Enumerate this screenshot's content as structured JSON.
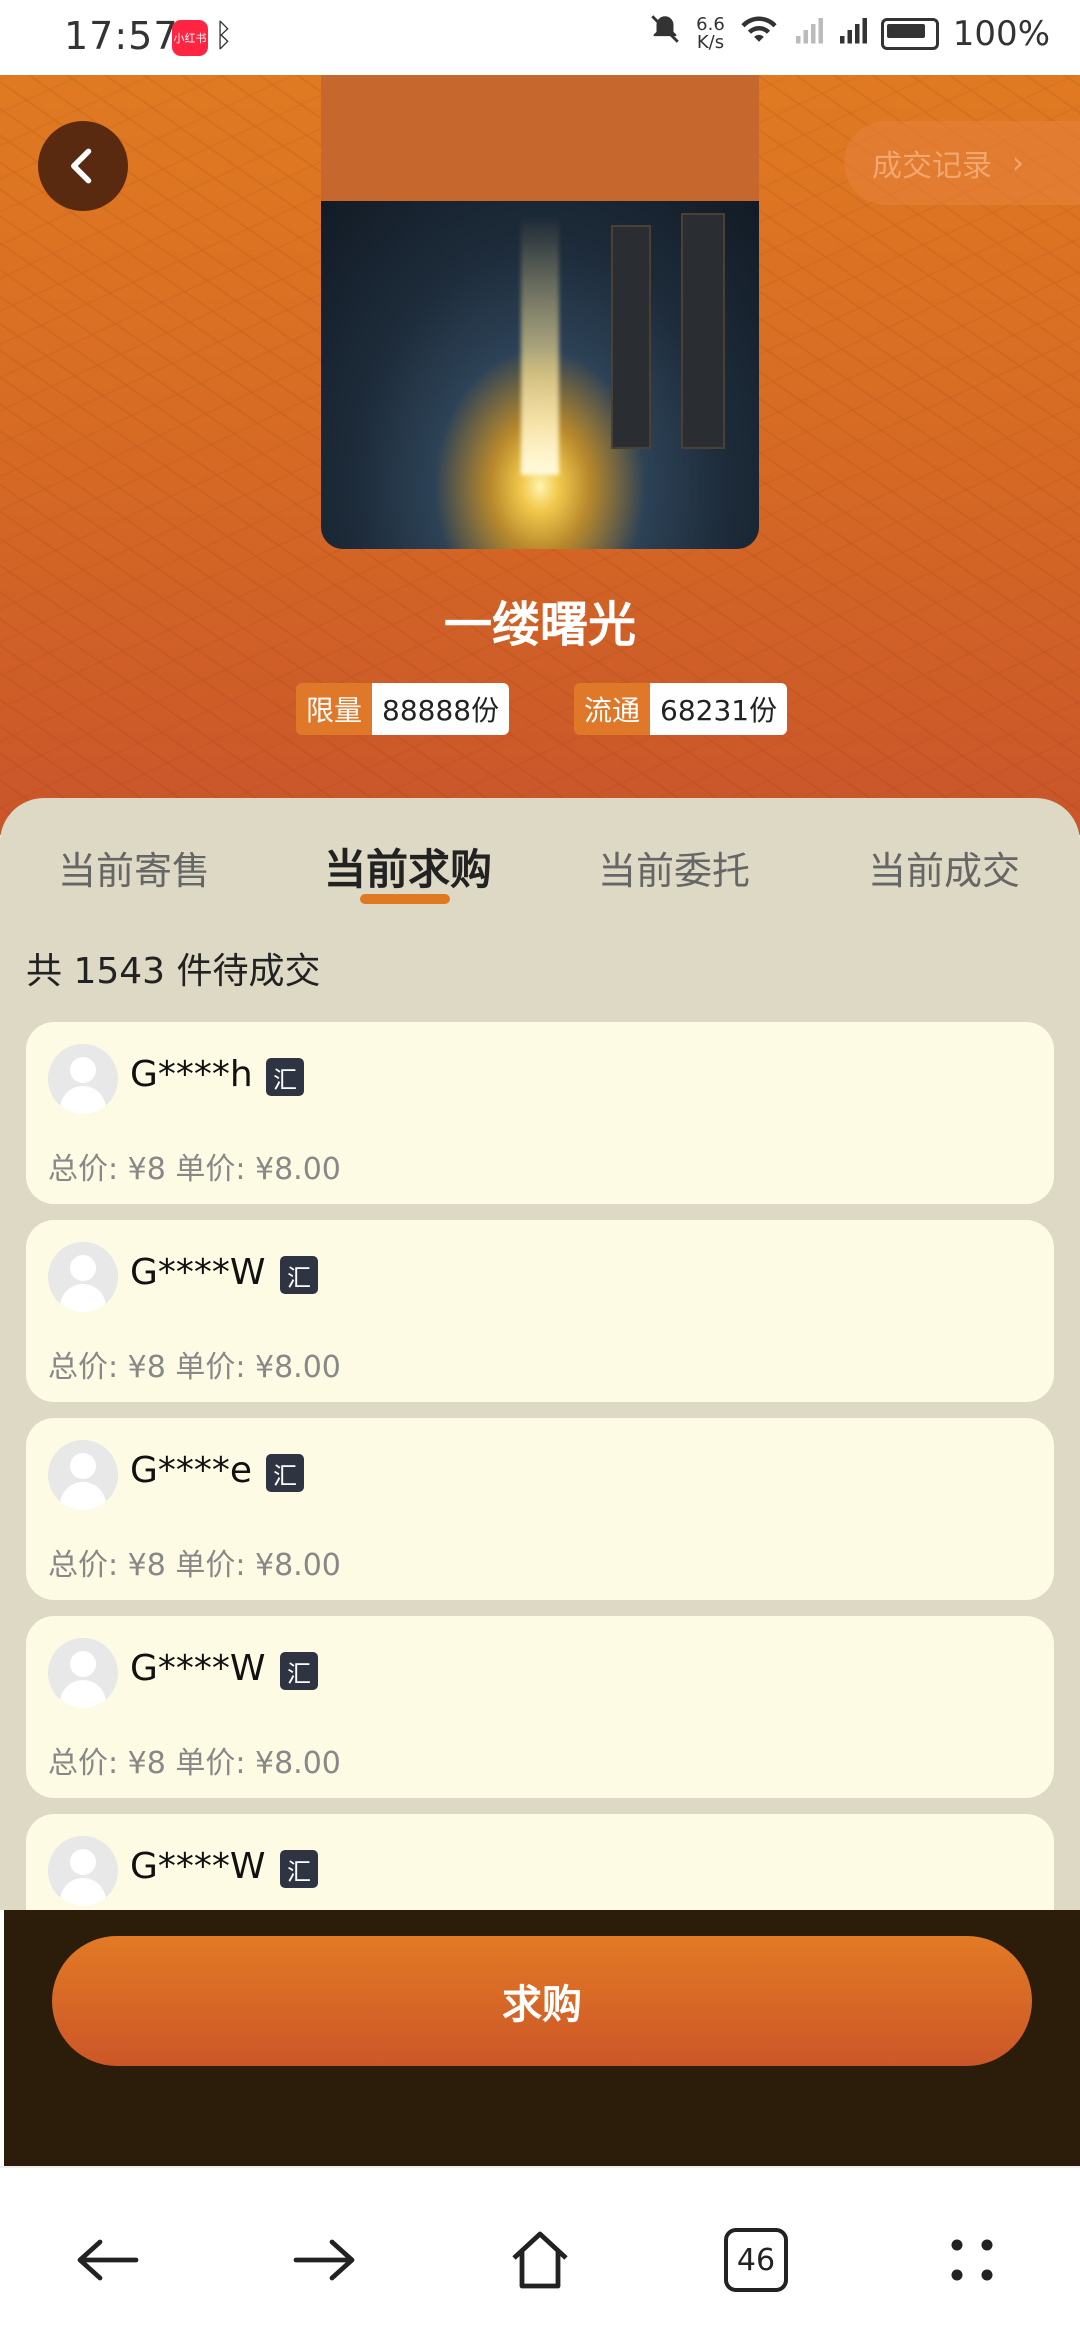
{
  "status_bar": {
    "time": "17:57",
    "app_icon": "小红书",
    "net_speed_top": "6.6",
    "net_speed_bottom": "K/s",
    "battery_percent": "100%"
  },
  "header": {
    "record_label": "成交记录",
    "title": "一缕曙光",
    "limit_label": "限量",
    "limit_value": "88888份",
    "circulation_label": "流通",
    "circulation_value": "68231份"
  },
  "tabs": [
    {
      "label": "当前寄售",
      "active": false
    },
    {
      "label": "当前求购",
      "active": true
    },
    {
      "label": "当前委托",
      "active": false
    },
    {
      "label": "当前成交",
      "active": false
    }
  ],
  "summary": "共 1543 件待成交",
  "orders": [
    {
      "user": "G****h",
      "badge": "汇",
      "price": "总价: ¥8 单价: ¥8.00"
    },
    {
      "user": "G****W",
      "badge": "汇",
      "price": "总价: ¥8 单价: ¥8.00"
    },
    {
      "user": "G****e",
      "badge": "汇",
      "price": "总价: ¥8 单价: ¥8.00"
    },
    {
      "user": "G****W",
      "badge": "汇",
      "price": "总价: ¥8 单价: ¥8.00"
    },
    {
      "user": "G****W",
      "badge": "汇",
      "price": ""
    }
  ],
  "action": {
    "buy_label": "求购"
  },
  "browser_nav": {
    "tab_count": "46"
  },
  "colors": {
    "accent": "#e07a22",
    "panel_bg": "#ddd9c4",
    "card_bg": "#fefbe5",
    "bottom_bar_bg": "#2b1d0a"
  }
}
